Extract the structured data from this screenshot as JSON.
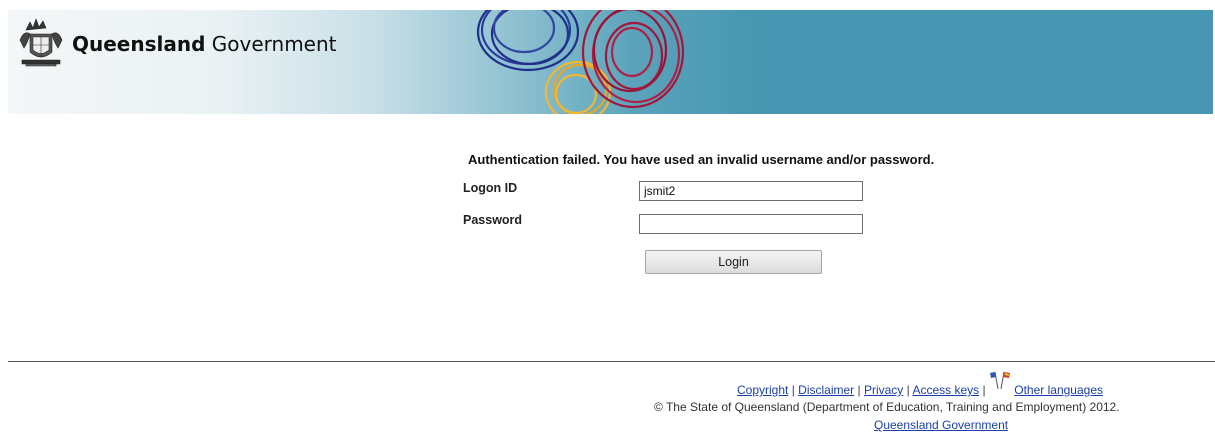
{
  "header": {
    "gov_name_bold": "Queensland",
    "gov_name_rest": "Government",
    "crest_icon": "queensland-coat-of-arms-icon",
    "swirl_colors": [
      "#1f2f8a",
      "#a3163b",
      "#f2b733"
    ]
  },
  "login": {
    "error_message": "Authentication failed. You have used an invalid username and/or password.",
    "logon_label": "Logon ID",
    "logon_value": "jsmit2",
    "password_label": "Password",
    "password_value": "",
    "button_label": "Login"
  },
  "footer": {
    "links": {
      "copyright": "Copyright",
      "disclaimer": "Disclaimer",
      "privacy": "Privacy",
      "access_keys": "Access keys",
      "other_languages": "Other languages"
    },
    "separator": " | ",
    "flags_icon": "flags-icon",
    "copyright_text": "© The State of Queensland (Department of Education, Training and Employment) 2012.",
    "gov_link": "Queensland Government"
  }
}
